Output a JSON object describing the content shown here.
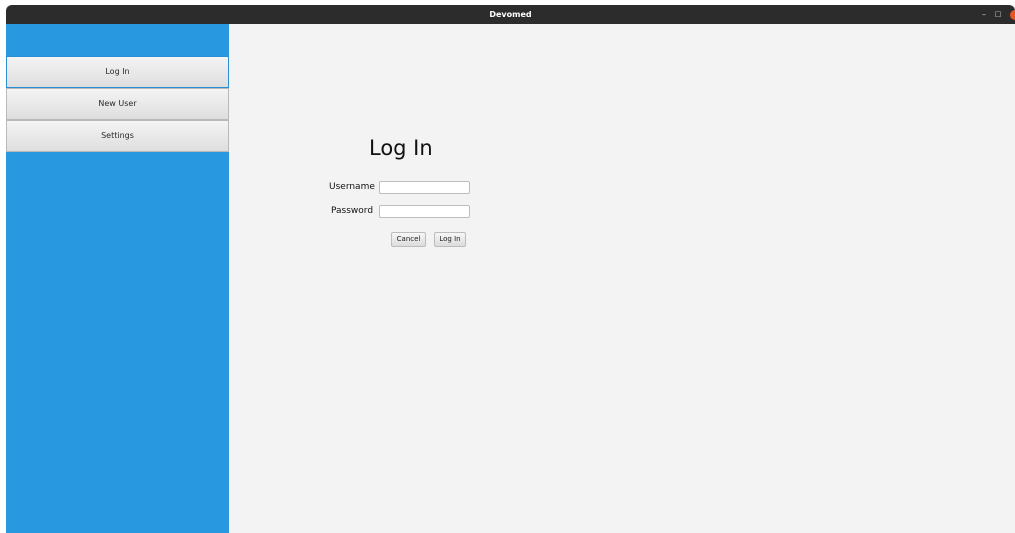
{
  "window": {
    "title": "Devomed",
    "minimize_glyph": "–",
    "maximize_glyph": "□",
    "close_glyph": "×",
    "close_color": "#e95420"
  },
  "sidebar": {
    "background": "#2898e0",
    "items": [
      {
        "label": "Log In",
        "active": true
      },
      {
        "label": "New User",
        "active": false
      },
      {
        "label": "Settings",
        "active": false
      }
    ]
  },
  "login_form": {
    "heading": "Log In",
    "username_label": "Username",
    "username_value": "",
    "password_label": "Password",
    "password_value": "",
    "cancel_label": "Cancel",
    "submit_label": "Log In"
  }
}
